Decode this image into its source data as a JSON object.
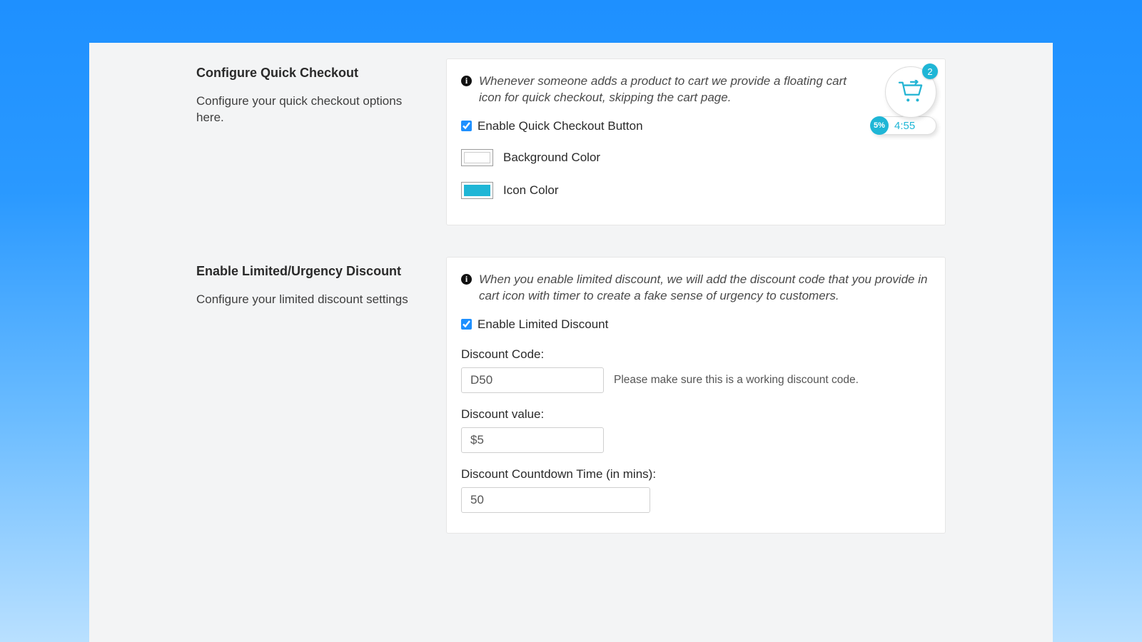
{
  "sections": {
    "quick": {
      "title": "Configure Quick Checkout",
      "subtitle": "Configure your quick checkout options here.",
      "info": "Whenever someone adds a product to cart we provide a floating cart icon for quick checkout, skipping the cart page.",
      "enable_label": "Enable Quick Checkout Button",
      "enable_checked": true,
      "bg_label": "Background Color",
      "bg_color": "#ffffff",
      "icon_label": "Icon Color",
      "icon_color": "#1fb6d6"
    },
    "discount": {
      "title": "Enable Limited/Urgency Discount",
      "subtitle": "Configure your limited discount settings",
      "info": "When you enable limited discount, we will add the discount code that you provide in cart icon with timer to create a fake sense of urgency to customers.",
      "enable_label": "Enable Limited Discount",
      "enable_checked": true,
      "code_label": "Discount Code:",
      "code_value": "D50",
      "code_hint": "Please make sure this is a working discount code.",
      "value_label": "Discount value:",
      "value_value": "$5",
      "countdown_label": "Discount Countdown Time (in mins):",
      "countdown_value": "50"
    }
  },
  "cart_widget": {
    "count": "2",
    "discount_badge": "5%",
    "timer": "4:55"
  }
}
